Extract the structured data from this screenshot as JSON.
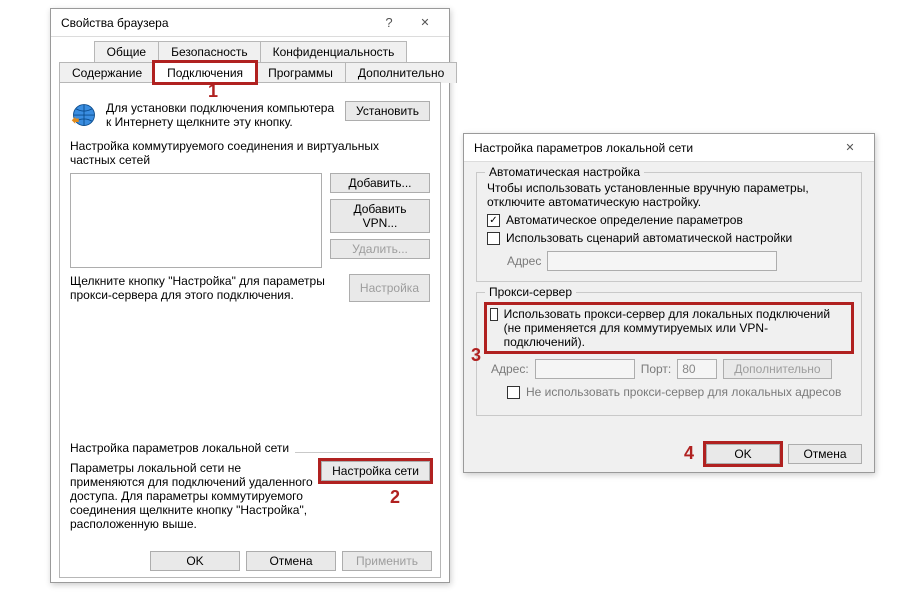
{
  "annotations": {
    "n1": "1",
    "n2": "2",
    "n3": "3",
    "n4": "4"
  },
  "win1": {
    "title": "Свойства браузера",
    "tabs_row1": {
      "general": "Общие",
      "security": "Безопасность",
      "privacy": "Конфиденциальность"
    },
    "tabs_row2": {
      "content": "Содержание",
      "connections": "Подключения",
      "programs": "Программы",
      "advanced": "Дополнительно"
    },
    "setup_text": "Для установки подключения компьютера к Интернету щелкните эту кнопку.",
    "setup_button": "Установить",
    "dialup_section": "Настройка коммутируемого соединения и виртуальных частных сетей",
    "buttons": {
      "add": "Добавить...",
      "add_vpn": "Добавить VPN...",
      "remove": "Удалить...",
      "settings": "Настройка"
    },
    "settings_hint": "Щелкните кнопку \"Настройка\" для параметры прокси-сервера для этого подключения.",
    "lan_section": "Настройка параметров локальной сети",
    "lan_hint": "Параметры локальной сети не применяются для подключений удаленного доступа. Для параметры коммутируемого соединения щелкните кнопку \"Настройка\", расположенную выше.",
    "lan_button": "Настройка сети",
    "footer": {
      "ok": "OK",
      "cancel": "Отмена",
      "apply": "Применить"
    }
  },
  "win2": {
    "title": "Настройка параметров локальной сети",
    "auto_group": "Автоматическая настройка",
    "auto_desc": "Чтобы использовать установленные вручную параметры, отключите автоматическую настройку.",
    "auto_detect": "Автоматическое определение параметров",
    "use_script": "Использовать сценарий автоматической настройки",
    "addr_label": "Адрес",
    "proxy_group": "Прокси-сервер",
    "use_proxy": "Использовать прокси-сервер для локальных подключений (не применяется для коммутируемых или VPN-подключений).",
    "addr2_label": "Адрес:",
    "port_label": "Порт:",
    "port_value": "80",
    "advanced_btn": "Дополнительно",
    "bypass_local": "Не использовать прокси-сервер для локальных адресов",
    "footer": {
      "ok": "OK",
      "cancel": "Отмена"
    }
  }
}
